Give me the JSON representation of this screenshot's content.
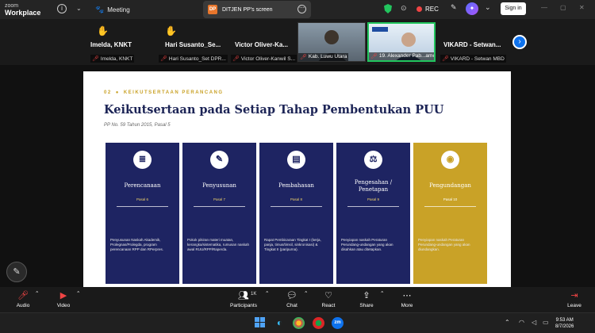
{
  "brand": {
    "line1": "zoom",
    "line2": "Workplace"
  },
  "topbar": {
    "meeting_label": "Meeting",
    "share_badge": "DP",
    "share_title": "DITJEN PP's screen",
    "rec_label": "REC",
    "signin_label": "Sign in"
  },
  "participants": [
    {
      "big": "Imelda, KNKT",
      "small": "Imelda, KNKT",
      "hand": true
    },
    {
      "big": "Hari Susanto_Se...",
      "small": "Hari Susanto_Set DPR...",
      "hand": true
    },
    {
      "big": "Victor Oliver-Ka...",
      "small": "Victor Oliver-Kanwil S...",
      "hand": false
    },
    {
      "big": "VIKARD - Setwan...",
      "small": "VIKARD - Setwan MBD",
      "hand": false
    }
  ],
  "videos": [
    {
      "caption": "Kab. Luwu Utara"
    },
    {
      "caption": "19. Alexander Pab...ame..."
    }
  ],
  "slide": {
    "eyebrow_num": "02",
    "eyebrow_text": "KEIKUTSERTAAN PERANCANG",
    "title": "Keikutsertaan pada Setiap Tahap Pembentukan PUU",
    "subtitle": "PP No. 59 Tahun 2015, Pasal 5",
    "cards": [
      {
        "icon": "document-icon",
        "title": "Perencanaan",
        "pasal": "Pasal 6",
        "desc": "Penyusunan Naskah Akademik, Prolegnas/Prolegda, program perencanaan RPP dan RPerpres."
      },
      {
        "icon": "pencil-icon",
        "title": "Penyusunan",
        "pasal": "Pasal 7",
        "desc": "Pokok pikiran materi muatan, kerangka/sistematika, rumusan naskah awal RUU/RPP/Raperda."
      },
      {
        "icon": "chat-icon",
        "title": "Pembahasan",
        "pasal": "Pasal 8",
        "desc": "Rapat Pembicaraan Tingkat I (kerja, panja, timus/timsil, sinkronisasi) & Tingkat II (paripurna)."
      },
      {
        "icon": "gavel-icon",
        "title": "Pengesahan / Penetapan",
        "pasal": "Pasal 9",
        "desc": "Penyiapan naskah Peraturan Perundang-undangan yang akan disahkan atau ditetapkan."
      },
      {
        "icon": "globe-icon",
        "title": "Pengundangan",
        "pasal": "Pasal 10",
        "desc": "Penyiapan naskah Peraturan Perundang-undangan yang akan diundangkan."
      }
    ]
  },
  "toolbar": {
    "audio": "Audio",
    "video": "Video",
    "participants": "Participants",
    "participants_count": "1K",
    "chat": "Chat",
    "react": "React",
    "share": "Share",
    "more": "More",
    "leave": "Leave"
  },
  "taskbar": {
    "time": "9:53 AM",
    "date": "8/7/2026"
  },
  "colors": {
    "card_navy": "#1e2462",
    "card_gold": "#c9a227",
    "title_navy": "#1c2456",
    "zoom_blue": "#0e72ed",
    "rec_red": "#ef4444"
  }
}
